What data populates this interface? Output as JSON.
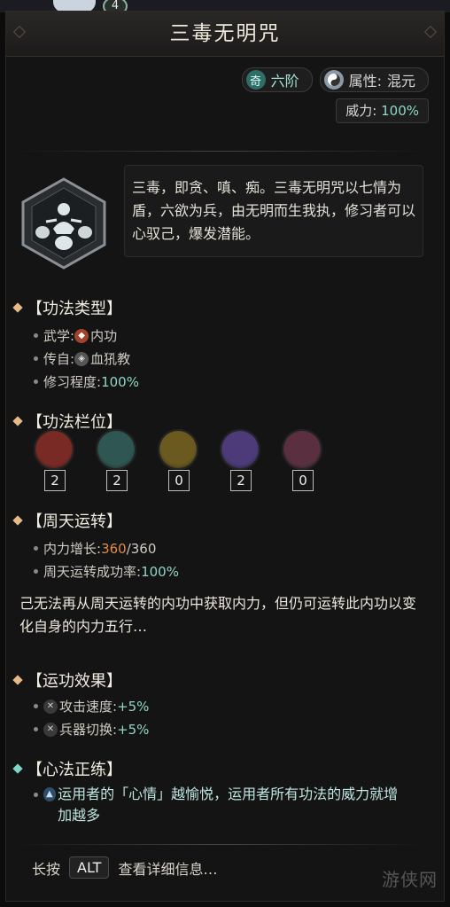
{
  "topbar": {
    "badge": "4"
  },
  "title": "三毒无明咒",
  "tags": {
    "rank_icon": "奇",
    "rank": "六阶",
    "attr_icon": "yin-yang-icon",
    "attr_label": "属性:",
    "attr_value": "混元",
    "power_label": "威力:",
    "power_value": "100%"
  },
  "description": "三毒，即贪、嗔、痴。三毒无明咒以七情为盾，六欲为兵，由无明而生我执，修习者可以心驭己，爆发潜能。",
  "section_type": {
    "title": "【功法类型】",
    "martial_label": "武学:",
    "martial_value": "内功",
    "source_label": "传自:",
    "source_value": "血犼教",
    "progress_label": "修习程度:",
    "progress_value": "100%"
  },
  "section_slots": {
    "title": "【功法栏位】",
    "slots": [
      {
        "value": "2",
        "color": "#7a2a24"
      },
      {
        "value": "2",
        "color": "#2f5652"
      },
      {
        "value": "0",
        "color": "#6a5a20"
      },
      {
        "value": "2",
        "color": "#4d3a78"
      },
      {
        "value": "0",
        "color": "#5a3040"
      }
    ]
  },
  "section_cycle": {
    "title": "【周天运转】",
    "gain_label": "内力增长:",
    "gain_current": "360",
    "gain_max": "/360",
    "rate_label": "周天运转成功率:",
    "rate_value": "100%"
  },
  "note": "己无法再从周天运转的内功中获取内力，但仍可运转此内功以变化自身的内力五行…",
  "section_effect": {
    "title": "【运功效果】",
    "effects": [
      {
        "label": "攻击速度:",
        "value": "+5%"
      },
      {
        "label": "兵器切换:",
        "value": "+5%"
      }
    ]
  },
  "section_mind": {
    "title": "【心法正练】",
    "text": "运用者的「心情」越愉悦，运用者所有功法的威力就增加越多"
  },
  "hint": {
    "prefix": "长按",
    "key": "ALT",
    "suffix": "查看详细信息…"
  },
  "watermark": "游侠网"
}
